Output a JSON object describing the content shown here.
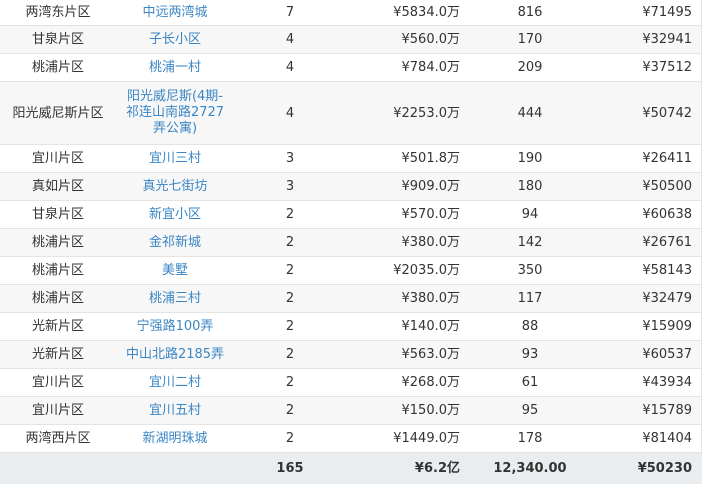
{
  "rows": [
    {
      "area": "两湾东片区",
      "name": "中远两湾城",
      "count": "7",
      "price": "¥5834.0万",
      "num": "816",
      "unit": "¥71495"
    },
    {
      "area": "甘泉片区",
      "name": "子长小区",
      "count": "4",
      "price": "¥560.0万",
      "num": "170",
      "unit": "¥32941"
    },
    {
      "area": "桃浦片区",
      "name": "桃浦一村",
      "count": "4",
      "price": "¥784.0万",
      "num": "209",
      "unit": "¥37512"
    },
    {
      "area": "阳光威尼斯片区",
      "name": "阳光威尼斯(4期-祁连山南路2727弄公寓)",
      "count": "4",
      "price": "¥2253.0万",
      "num": "444",
      "unit": "¥50742"
    },
    {
      "area": "宜川片区",
      "name": "宜川三村",
      "count": "3",
      "price": "¥501.8万",
      "num": "190",
      "unit": "¥26411"
    },
    {
      "area": "真如片区",
      "name": "真光七街坊",
      "count": "3",
      "price": "¥909.0万",
      "num": "180",
      "unit": "¥50500"
    },
    {
      "area": "甘泉片区",
      "name": "新宜小区",
      "count": "2",
      "price": "¥570.0万",
      "num": "94",
      "unit": "¥60638"
    },
    {
      "area": "桃浦片区",
      "name": "金祁新城",
      "count": "2",
      "price": "¥380.0万",
      "num": "142",
      "unit": "¥26761"
    },
    {
      "area": "桃浦片区",
      "name": "美墅",
      "count": "2",
      "price": "¥2035.0万",
      "num": "350",
      "unit": "¥58143"
    },
    {
      "area": "桃浦片区",
      "name": "桃浦三村",
      "count": "2",
      "price": "¥380.0万",
      "num": "117",
      "unit": "¥32479"
    },
    {
      "area": "光新片区",
      "name": "宁强路100弄",
      "count": "2",
      "price": "¥140.0万",
      "num": "88",
      "unit": "¥15909"
    },
    {
      "area": "光新片区",
      "name": "中山北路2185弄",
      "count": "2",
      "price": "¥563.0万",
      "num": "93",
      "unit": "¥60537"
    },
    {
      "area": "宜川片区",
      "name": "宜川二村",
      "count": "2",
      "price": "¥268.0万",
      "num": "61",
      "unit": "¥43934"
    },
    {
      "area": "宜川片区",
      "name": "宜川五村",
      "count": "2",
      "price": "¥150.0万",
      "num": "95",
      "unit": "¥15789"
    },
    {
      "area": "两湾西片区",
      "name": "新湖明珠城",
      "count": "2",
      "price": "¥1449.0万",
      "num": "178",
      "unit": "¥81404"
    }
  ],
  "total": {
    "area": "",
    "name": "",
    "count": "165",
    "price": "¥6.2亿",
    "num": "12,340.00",
    "unit": "¥50230"
  },
  "colors": {
    "link": "#3b86c4",
    "text": "#333333",
    "row_alt": "#f7f7f7",
    "total_bg": "#e9edf0"
  }
}
